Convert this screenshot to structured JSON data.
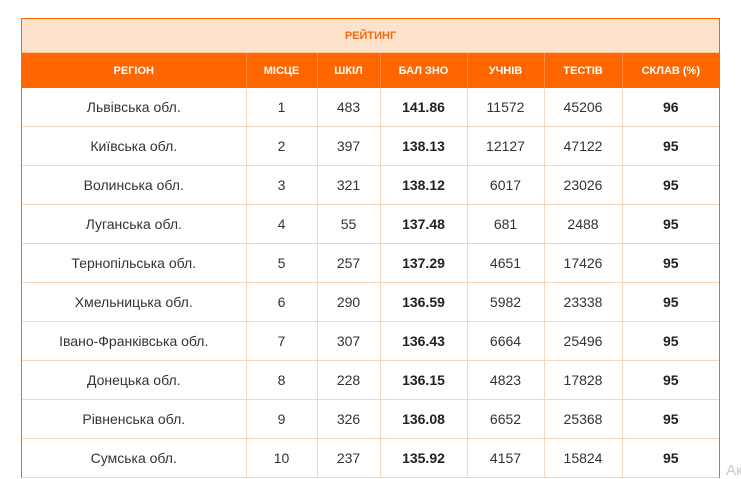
{
  "title": "РЕЙТИНГ",
  "columns": [
    "РЕГІОН",
    "МІСЦЕ",
    "ШКІЛ",
    "БАЛ ЗНО",
    "УЧНІВ",
    "ТЕСТІВ",
    "СКЛАВ (%)"
  ],
  "rows": [
    [
      "Львівська обл.",
      "1",
      "483",
      "141.86",
      "11572",
      "45206",
      "96"
    ],
    [
      "Київська обл.",
      "2",
      "397",
      "138.13",
      "12127",
      "47122",
      "95"
    ],
    [
      "Волинська обл.",
      "3",
      "321",
      "138.12",
      "6017",
      "23026",
      "95"
    ],
    [
      "Луганська обл.",
      "4",
      "55",
      "137.48",
      "681",
      "2488",
      "95"
    ],
    [
      "Тернопільська обл.",
      "5",
      "257",
      "137.29",
      "4651",
      "17426",
      "95"
    ],
    [
      "Хмельницька обл.",
      "6",
      "290",
      "136.59",
      "5982",
      "23338",
      "95"
    ],
    [
      "Івано-Франківська обл.",
      "7",
      "307",
      "136.43",
      "6664",
      "25496",
      "95"
    ],
    [
      "Донецька обл.",
      "8",
      "228",
      "136.15",
      "4823",
      "17828",
      "95"
    ],
    [
      "Рівненська обл.",
      "9",
      "326",
      "136.08",
      "6652",
      "25368",
      "95"
    ],
    [
      "Сумська обл.",
      "10",
      "237",
      "135.92",
      "4157",
      "15824",
      "95"
    ]
  ],
  "corner_text": "Ак",
  "colors": {
    "accent": "#ff6600",
    "title_bg": "#fde3cc",
    "title_text": "#f26a10"
  }
}
